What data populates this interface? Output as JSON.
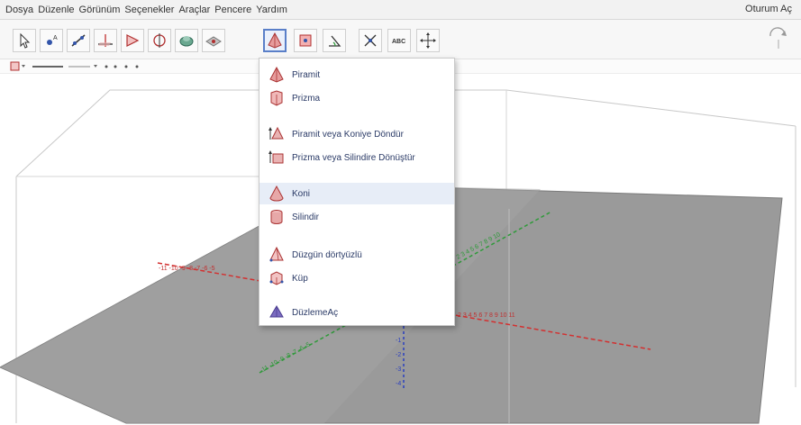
{
  "menubar": {
    "items": [
      "Dosya",
      "Düzenle",
      "Görünüm",
      "Seçenekler",
      "Araçlar",
      "Pencere",
      "Yardım"
    ],
    "signin": "Oturum Aç"
  },
  "toolbar": {
    "tools": [
      {
        "icon": "move-icon"
      },
      {
        "icon": "point-icon"
      },
      {
        "icon": "line-icon"
      },
      {
        "icon": "perpendicular-line-icon"
      },
      {
        "icon": "polygon-icon"
      },
      {
        "icon": "circle-axis-icon"
      },
      {
        "icon": "intersect-surfaces-icon"
      },
      {
        "icon": "plane-icon"
      },
      {
        "icon": "pyramid-tool-icon",
        "active": true
      },
      {
        "icon": "reflect-icon"
      },
      {
        "icon": "angle-icon"
      },
      {
        "icon": "reflect-plane-icon"
      },
      {
        "icon": "text-icon",
        "text": "ABC"
      },
      {
        "icon": "move-view-icon"
      }
    ]
  },
  "dropdown": {
    "items": [
      {
        "label": "Piramit",
        "icon": "pyramid-icon"
      },
      {
        "label": "Prizma",
        "icon": "prism-icon"
      },
      {
        "label": "Piramit veya Koniye Döndür",
        "icon": "extrude-pyramid-icon"
      },
      {
        "label": "Prizma veya Silindire Dönüştür",
        "icon": "extrude-prism-icon"
      },
      {
        "label": "Koni",
        "icon": "cone-icon",
        "hover": true
      },
      {
        "label": "Silindir",
        "icon": "cylinder-icon"
      },
      {
        "label": "Düzgün dörtyüzlü",
        "icon": "tetrahedron-icon"
      },
      {
        "label": "Küp",
        "icon": "cube-icon"
      },
      {
        "label": "DüzlemeAç",
        "icon": "net-icon"
      }
    ]
  },
  "colors": {
    "accent": "#5a7fc8",
    "x_axis": "#d33030",
    "y_axis": "#2f9a3a",
    "z_axis": "#2a3fbf",
    "plane": "#8f8f8f"
  }
}
